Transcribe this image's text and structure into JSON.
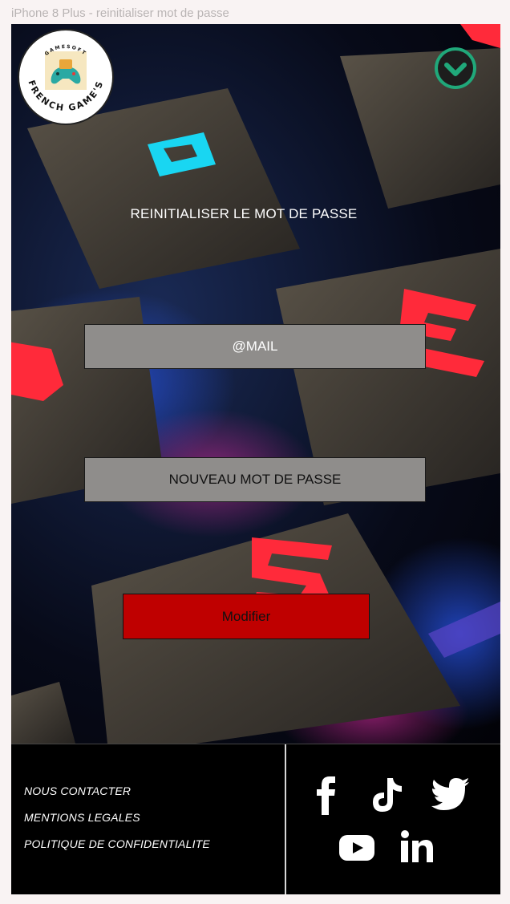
{
  "frame": {
    "title": "iPhone 8 Plus - reinitialiser mot de passe"
  },
  "logo": {
    "top_text": "GAMESOFT",
    "bottom_text": "FRENCH GAME'S"
  },
  "menu_toggle": {
    "icon": "chevron-down-icon",
    "color": "#20a87a"
  },
  "heading": "REINITIALISER LE MOT DE PASSE",
  "form": {
    "email_label": "@MAIL",
    "password_label": "NOUVEAU MOT DE PASSE",
    "submit_label": "Modifier",
    "submit_color": "#bf0000"
  },
  "footer": {
    "links": [
      {
        "label": "NOUS CONTACTER"
      },
      {
        "label": "MENTIONS LEGALES"
      },
      {
        "label": "POLITIQUE DE CONFIDENTIALITE"
      }
    ],
    "social": [
      "facebook-icon",
      "tiktok-icon",
      "twitter-icon",
      "youtube-icon",
      "linkedin-icon"
    ]
  }
}
